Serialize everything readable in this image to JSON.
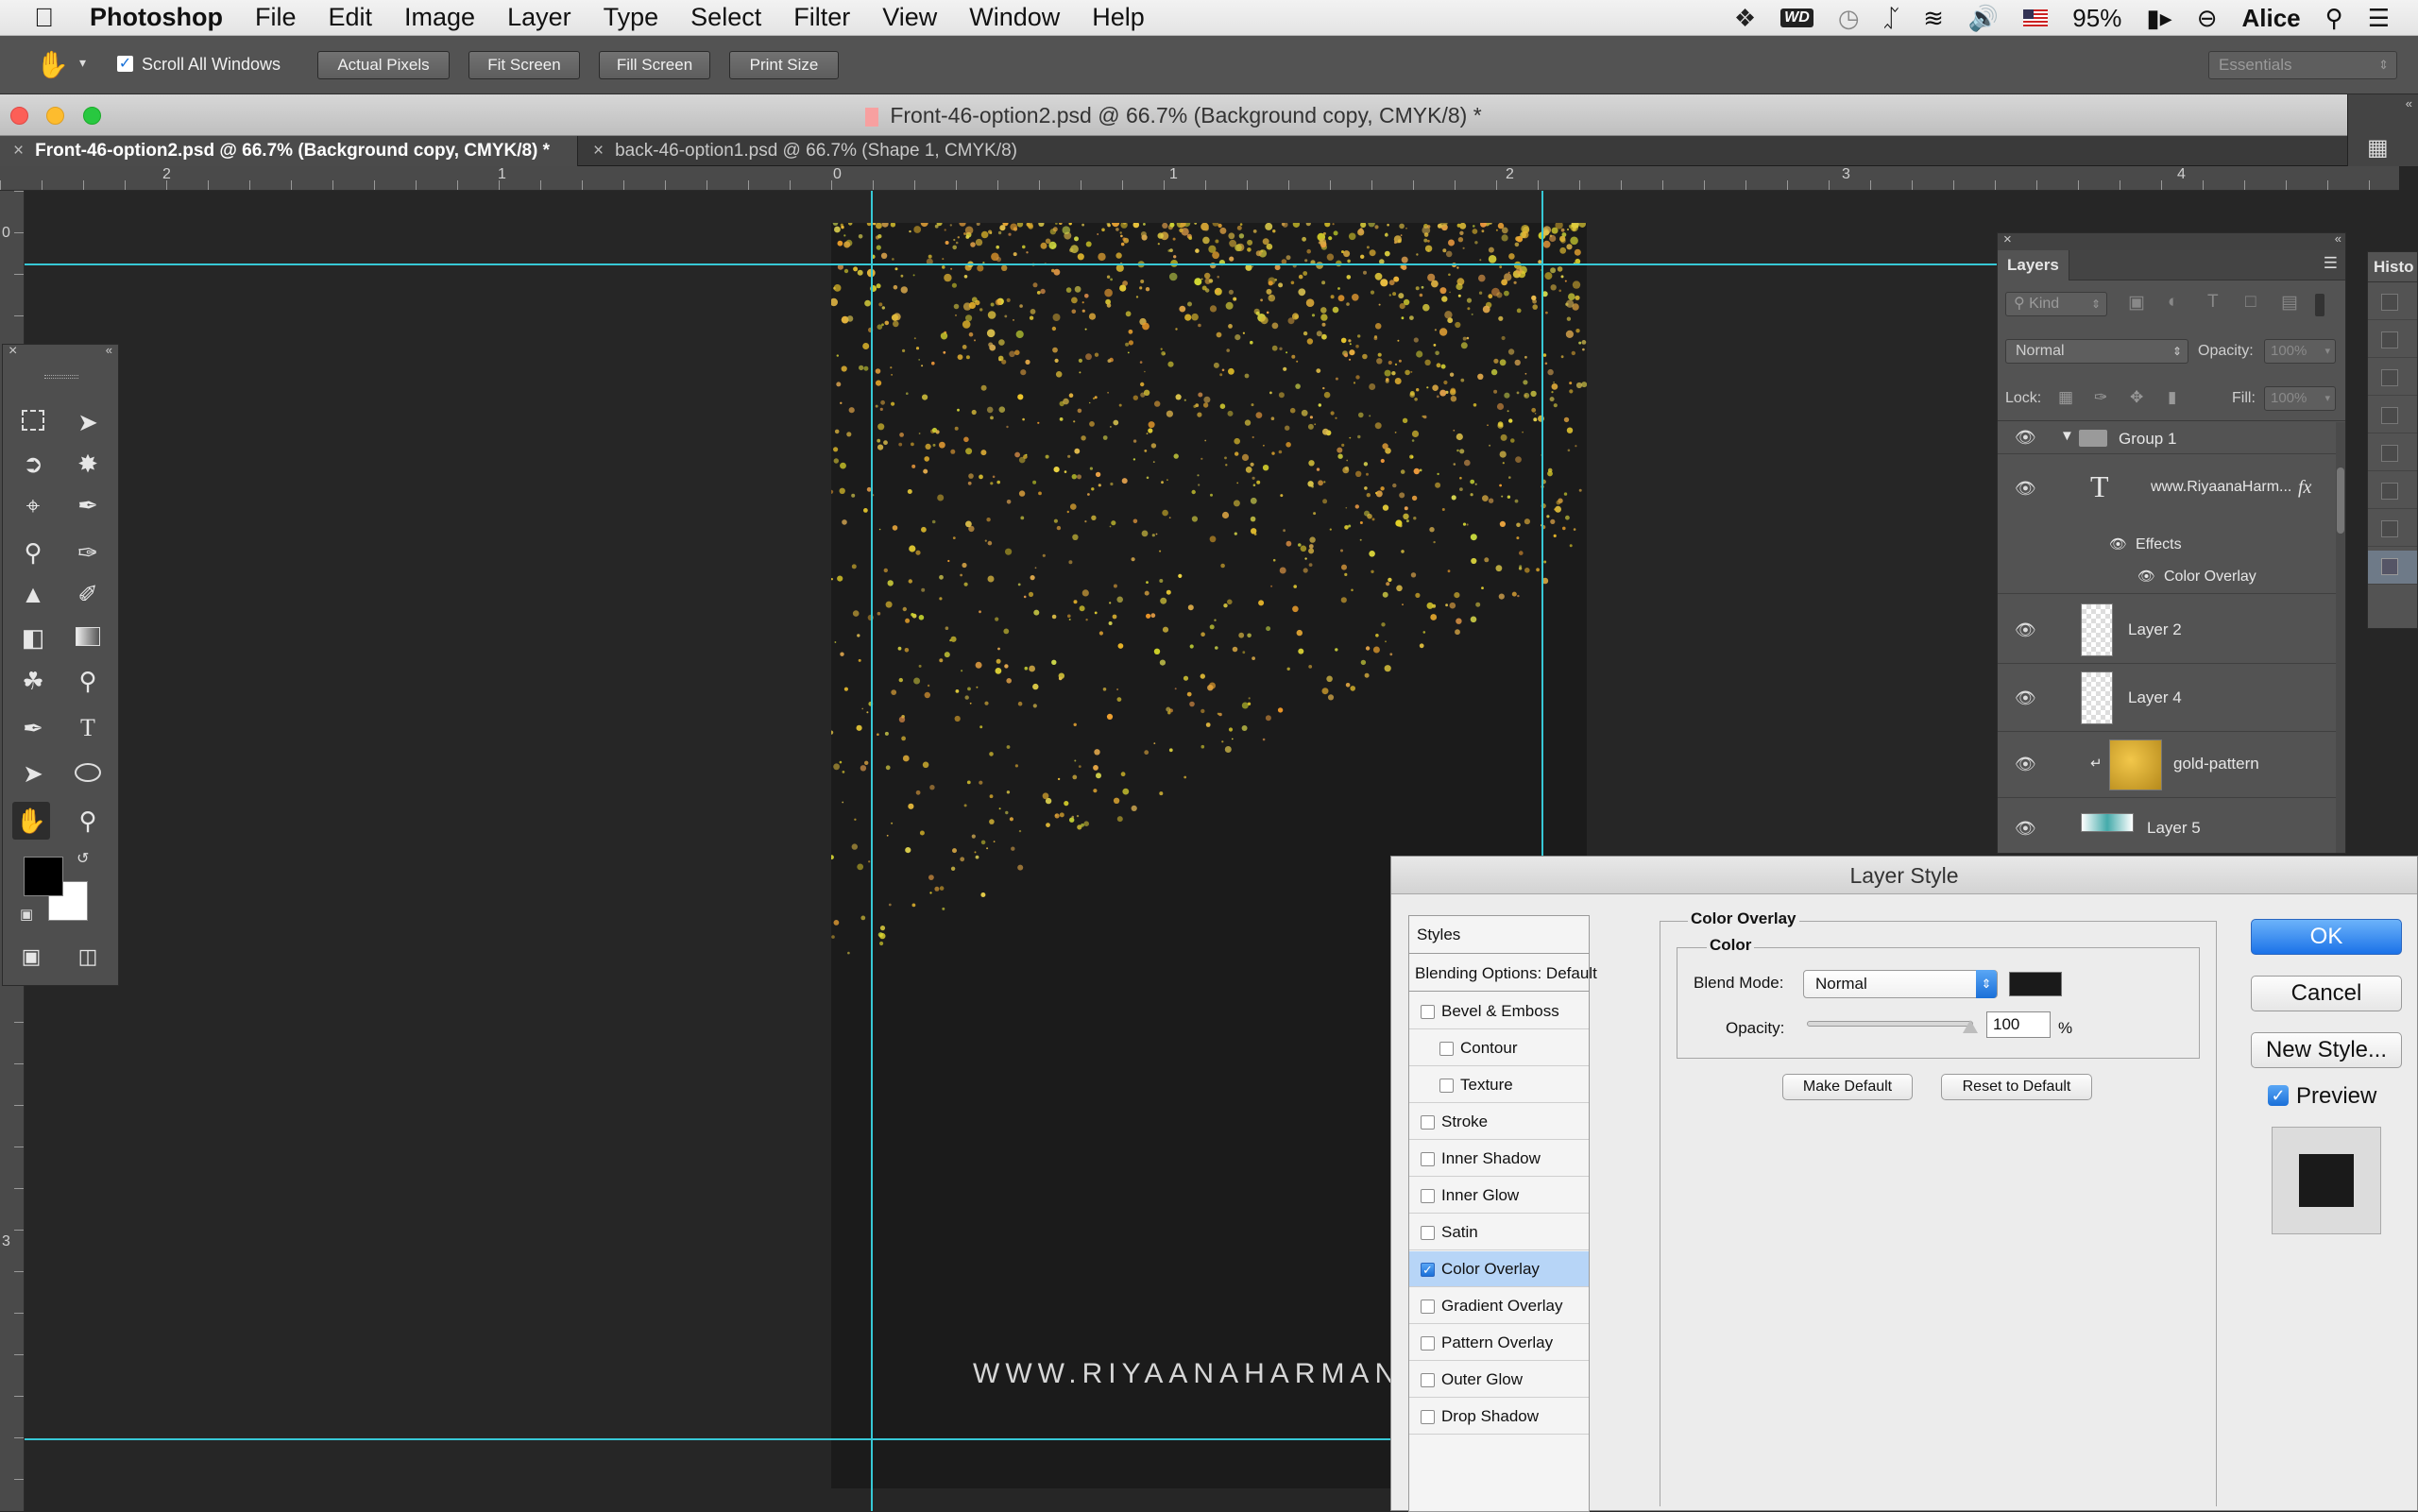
{
  "menubar": {
    "app_name": "Photoshop",
    "items": [
      "File",
      "Edit",
      "Image",
      "Layer",
      "Type",
      "Select",
      "Filter",
      "View",
      "Window",
      "Help"
    ],
    "battery": "95%",
    "user": "Alice",
    "drive_label": "WD"
  },
  "options_bar": {
    "scroll_all_windows": "Scroll All Windows",
    "actual_pixels": "Actual Pixels",
    "fit_screen": "Fit Screen",
    "fill_screen": "Fill Screen",
    "print_size": "Print Size",
    "workspace": "Essentials"
  },
  "document": {
    "window_title": "Front-46-option2.psd @ 66.7% (Background copy, CMYK/8) *",
    "tabs": [
      {
        "label": "Front-46-option2.psd @ 66.7% (Background copy, CMYK/8) *",
        "active": true
      },
      {
        "label": "back-46-option1.psd @ 66.7% (Shape 1, CMYK/8)",
        "active": false
      }
    ],
    "ruler_h": [
      "2",
      "1",
      "0",
      "1",
      "2",
      "3",
      "4"
    ],
    "ruler_v": [
      "0",
      "3"
    ],
    "canvas_text": "WWW.RIYAANAHARMAN.C"
  },
  "layers_panel": {
    "title": "Layers",
    "kind": "Kind",
    "blend_mode": "Normal",
    "opacity_label": "Opacity:",
    "opacity_value": "100%",
    "lock_label": "Lock:",
    "fill_label": "Fill:",
    "fill_value": "100%",
    "rows": {
      "group": "Group 1",
      "text_layer": "www.RiyaanaHarm...",
      "fx": "fx",
      "effects": "Effects",
      "color_overlay": "Color Overlay",
      "layer2": "Layer 2",
      "layer4": "Layer 4",
      "gold": "gold-pattern",
      "layer5": "Layer 5"
    }
  },
  "history_panel": {
    "title": "Histo"
  },
  "layer_style": {
    "title": "Layer Style",
    "styles_header": "Styles",
    "blending": "Blending Options: Default",
    "styles": [
      {
        "label": "Bevel & Emboss",
        "checked": false,
        "indent": false
      },
      {
        "label": "Contour",
        "checked": false,
        "indent": true
      },
      {
        "label": "Texture",
        "checked": false,
        "indent": true
      },
      {
        "label": "Stroke",
        "checked": false,
        "indent": false
      },
      {
        "label": "Inner Shadow",
        "checked": false,
        "indent": false
      },
      {
        "label": "Inner Glow",
        "checked": false,
        "indent": false
      },
      {
        "label": "Satin",
        "checked": false,
        "indent": false
      },
      {
        "label": "Color Overlay",
        "checked": true,
        "indent": false
      },
      {
        "label": "Gradient Overlay",
        "checked": false,
        "indent": false
      },
      {
        "label": "Pattern Overlay",
        "checked": false,
        "indent": false
      },
      {
        "label": "Outer Glow",
        "checked": false,
        "indent": false
      },
      {
        "label": "Drop Shadow",
        "checked": false,
        "indent": false
      }
    ],
    "section_title": "Color Overlay",
    "group_title": "Color",
    "blend_mode_label": "Blend Mode:",
    "blend_mode_value": "Normal",
    "overlay_color": "#1a1a1a",
    "opacity_label": "Opacity:",
    "opacity_value": "100",
    "opacity_unit": "%",
    "make_default": "Make Default",
    "reset_default": "Reset to Default",
    "ok": "OK",
    "cancel": "Cancel",
    "new_style": "New Style...",
    "preview_label": "Preview"
  }
}
